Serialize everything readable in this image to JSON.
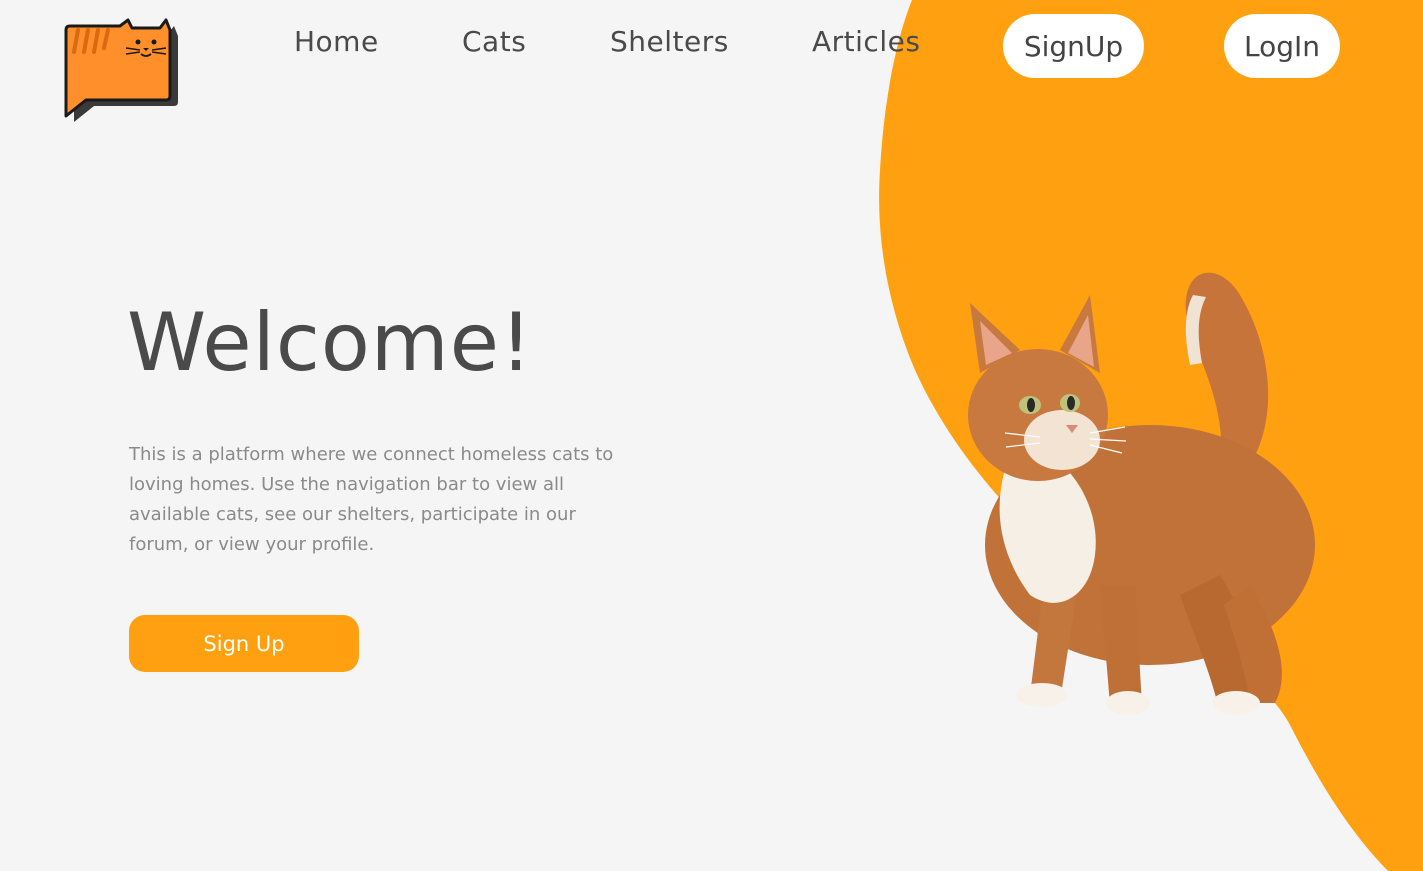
{
  "brand": {
    "logo_icon": "cat-speech-bubble-logo"
  },
  "nav": {
    "home": "Home",
    "cats": "Cats",
    "shelters": "Shelters",
    "articles": "Articles",
    "signup": "SignUp",
    "login": "LogIn"
  },
  "hero": {
    "title": "Welcome!",
    "description": "This is a platform where we connect homeless cats to loving homes. Use the navigation bar to view all available cats, see our shelters, participate in our forum, or view your profile.",
    "cta_label": "Sign Up",
    "image_icon": "orange-tabby-cat-photo"
  },
  "colors": {
    "accent": "#ffa010",
    "background": "#f5f5f5",
    "text_dark": "#4a4a4a",
    "text_muted": "#8a8a8a",
    "pill_bg": "#ffffff"
  }
}
